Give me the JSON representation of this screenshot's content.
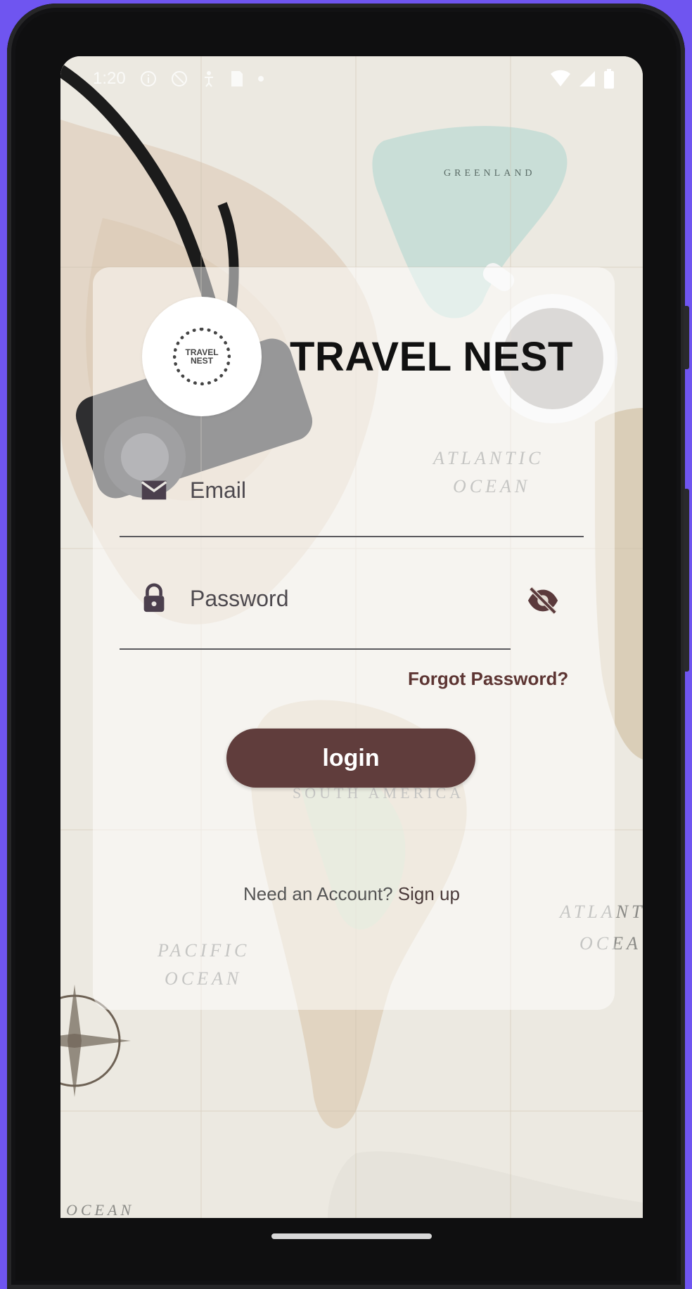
{
  "status_bar": {
    "time": "1:20"
  },
  "app": {
    "title": "TRAVEL NEST",
    "logo_text": "TRAVEL NEST"
  },
  "background_map": {
    "labels": [
      "GREENLAND",
      "ATLANTIC",
      "OCEAN",
      "SOUTH AMERICA",
      "PACIFIC",
      "OCEAN",
      "ATLANT",
      "OCEA",
      "OCEAN"
    ]
  },
  "login_form": {
    "email": {
      "placeholder": "Email",
      "value": "",
      "icon": "mail-icon"
    },
    "password": {
      "placeholder": "Password",
      "value": "",
      "icon": "lock-icon",
      "toggle_icon": "eye-off-icon"
    },
    "forgot_password": "Forgot Password?",
    "login_button": "login",
    "signup_prompt": "Need an Account?",
    "signup_link": "Sign up"
  },
  "colors": {
    "frame_background": "#6f55f0",
    "primary_button": "#603d3c",
    "link": "#5d3533",
    "card_overlay": "rgba(255,255,255,0.5)"
  }
}
